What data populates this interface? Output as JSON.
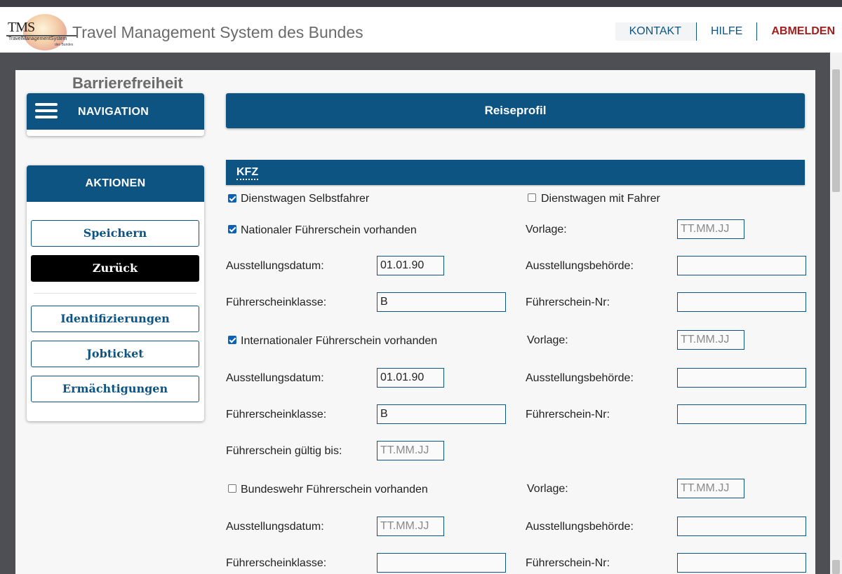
{
  "header": {
    "logo_text": "TMS",
    "logo_sub": "TravelManagementSystem",
    "logo_sub2": "des Bundes",
    "title": "Travel Management System des Bundes",
    "nav": {
      "contact": "KONTAKT",
      "help": "HILFE",
      "logout": "ABMELDEN"
    }
  },
  "accessibility_label": "Barrierefreiheit",
  "navigation": {
    "label": "NAVIGATION"
  },
  "actions": {
    "title": "AKTIONEN",
    "save": "Speichern",
    "back": "Zurück",
    "identifications": "Identifizierungen",
    "jobticket": "Jobticket",
    "authorizations": "Ermächtigungen"
  },
  "main": {
    "title": "Reiseprofil",
    "section": "KFZ",
    "placeholder_date": "TT.MM.JJ",
    "rows": {
      "dienstwagen_selbst": {
        "label": "Dienstwagen Selbstfahrer",
        "checked": true
      },
      "dienstwagen_fahrer": {
        "label": "Dienstwagen mit Fahrer",
        "checked": false
      },
      "national": {
        "label": "Nationaler Führerschein vorhanden",
        "checked": true,
        "vorlage_label": "Vorlage:",
        "vorlage": "",
        "date_label": "Ausstellungsdatum:",
        "date": "01.01.90",
        "authority_label": "Ausstellungsbehörde:",
        "authority": "",
        "class_label": "Führerscheinklasse:",
        "class": "B",
        "number_label": "Führerschein-Nr:",
        "number": ""
      },
      "international": {
        "label": "Internationaler Führerschein vorhanden",
        "checked": true,
        "vorlage_label": "Vorlage:",
        "vorlage": "",
        "date_label": "Ausstellungsdatum:",
        "date": "01.01.90",
        "authority_label": "Ausstellungsbehörde:",
        "authority": "",
        "class_label": "Führerscheinklasse:",
        "class": "B",
        "number_label": "Führerschein-Nr:",
        "number": "",
        "valid_label": "Führerschein gültig bis:",
        "valid": ""
      },
      "bundeswehr": {
        "label": "Bundeswehr Führerschein vorhanden",
        "checked": false,
        "vorlage_label": "Vorlage:",
        "vorlage": "",
        "date_label": "Ausstellungsdatum:",
        "date": "",
        "authority_label": "Ausstellungsbehörde:",
        "authority": "",
        "class_label": "Führerscheinklasse:",
        "class": "",
        "number_label": "Führerschein-Nr:",
        "number": ""
      }
    }
  }
}
